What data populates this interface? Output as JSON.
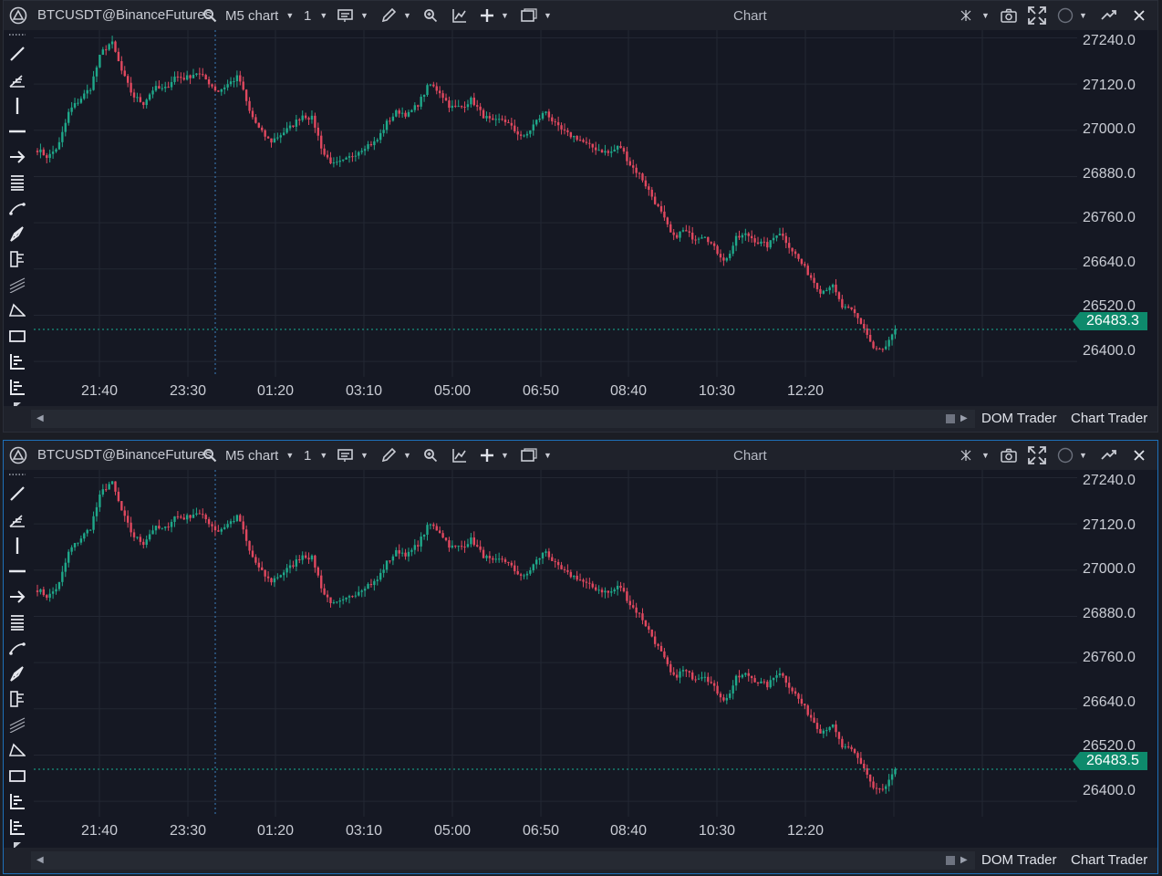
{
  "panels": [
    {
      "id": "panel-1",
      "symbol": "BTCUSDT@BinanceFutures",
      "timeframe": "M5 chart",
      "layout_count": "1",
      "title": "Chart",
      "last_price": "26483.3",
      "y_labels": [
        "27240.0",
        "27120.0",
        "27000.0",
        "26880.0",
        "26760.0",
        "26640.0",
        "26520.0",
        "26400.0"
      ],
      "x_labels": [
        "21:40",
        "23:30",
        "01:20",
        "03:10",
        "05:00",
        "06:50",
        "08:40",
        "10:30",
        "12:20"
      ],
      "tabs": [
        "DOM Trader",
        "Chart Trader"
      ]
    },
    {
      "id": "panel-2",
      "symbol": "BTCUSDT@BinanceFutures",
      "timeframe": "M5 chart",
      "layout_count": "1",
      "title": "Chart",
      "last_price": "26483.5",
      "y_labels": [
        "27240.0",
        "27120.0",
        "27000.0",
        "26880.0",
        "26760.0",
        "26640.0",
        "26520.0",
        "26400.0"
      ],
      "x_labels": [
        "21:40",
        "23:30",
        "01:20",
        "03:10",
        "05:00",
        "06:50",
        "08:40",
        "10:30",
        "12:20"
      ],
      "tabs": [
        "DOM Trader",
        "Chart Trader"
      ]
    }
  ],
  "colors": {
    "up": "#1fa88a",
    "down": "#e0485f",
    "background": "#151823",
    "grid": "#232733",
    "price_line": "#17b094",
    "crosshair": "#3b7fbf",
    "active_border": "#1e6fb8"
  },
  "toolbar_icons": [
    "line-icon",
    "fib-icon",
    "vertical-line-icon",
    "horizontal-line-icon",
    "arrow-icon",
    "levels-icon",
    "curve-icon",
    "brush-icon",
    "ruler-icon",
    "channel-icon",
    "triangle-icon",
    "rectangle-icon",
    "indicator-icon",
    "indicator-alt-icon"
  ],
  "chart_data": {
    "type": "candlestick",
    "price_range": [
      26360,
      27260
    ],
    "y_ticks": [
      27240,
      27120,
      27000,
      26880,
      26760,
      26640,
      26520,
      26400
    ],
    "anchor_closes": [
      26950,
      26930,
      26960,
      27050,
      27080,
      27110,
      27200,
      27230,
      27150,
      27090,
      27070,
      27110,
      27105,
      27140,
      27135,
      27150,
      27130,
      27100,
      27120,
      27140,
      27050,
      27000,
      26970,
      26990,
      27010,
      27040,
      27030,
      26940,
      26910,
      26920,
      26940,
      26960,
      26970,
      27020,
      27050,
      27040,
      27070,
      27120,
      27100,
      27060,
      27060,
      27080,
      27040,
      27020,
      27030,
      27000,
      26980,
      27020,
      27050,
      27010,
      26990,
      26980,
      26960,
      26950,
      26940,
      26960,
      26910,
      26880,
      26830,
      26780,
      26720,
      26740,
      26720,
      26730,
      26690,
      26660,
      26720,
      26730,
      26710,
      26700,
      26740,
      26700,
      26660,
      26620,
      26580,
      26600,
      26540,
      26530,
      26490,
      26430,
      26430,
      26480
    ],
    "last_price": 26483.3
  }
}
